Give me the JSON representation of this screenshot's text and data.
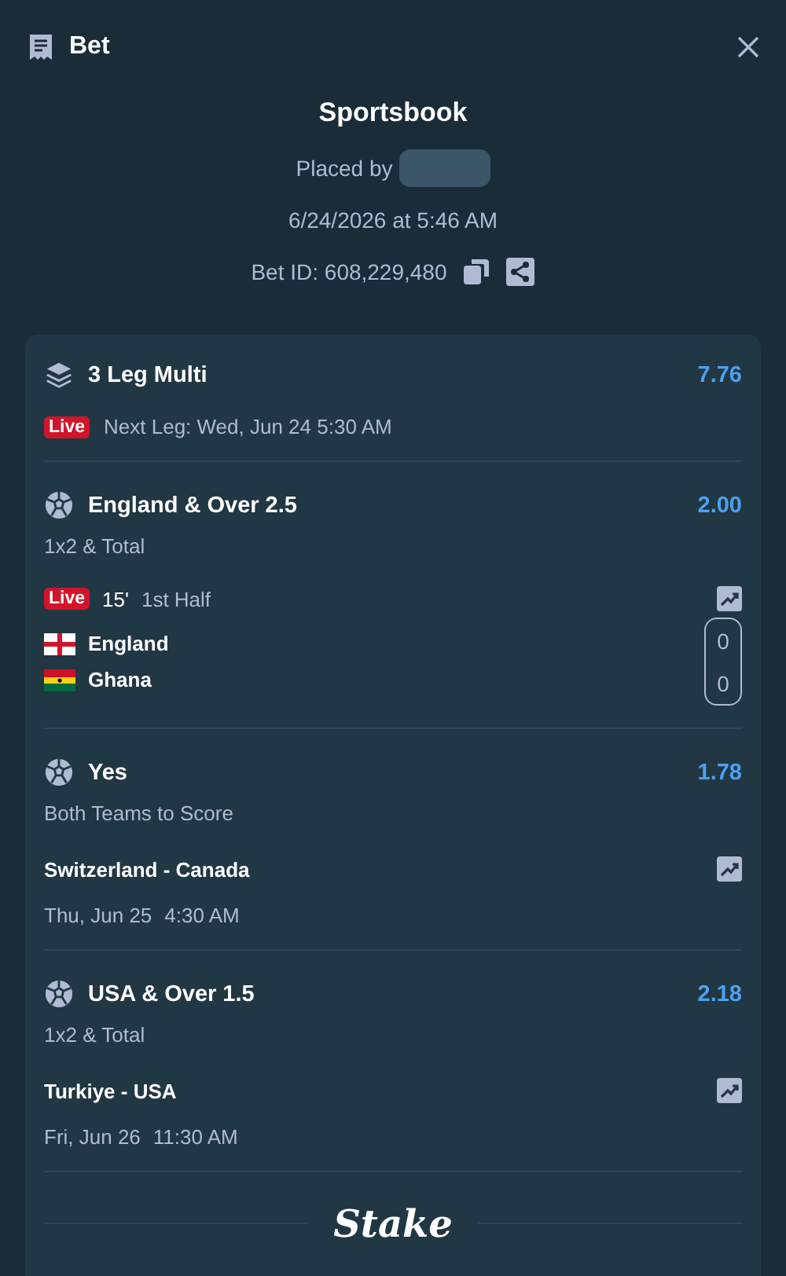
{
  "header": {
    "title": "Bet"
  },
  "summary": {
    "title": "Sportsbook",
    "placed_by": "Placed by",
    "date": "6/24/2026 at 5:46 AM",
    "bet_id": "Bet ID: 608,229,480"
  },
  "multi": {
    "title": "3 Leg Multi",
    "odds": "7.76",
    "live": true,
    "live_label": "Live",
    "next_leg": "Next Leg: Wed, Jun 24 5:30 AM"
  },
  "legs": [
    {
      "kind": "live",
      "selection": "England & Over 2.5",
      "odds": "2.00",
      "market": "1x2 & Total",
      "live_label": "Live",
      "minute": "15'",
      "period": "1st Half",
      "teams": [
        {
          "name": "England",
          "kind": "cross_flag",
          "score": "0"
        },
        {
          "name": "Ghana",
          "kind": "striped_flag",
          "score": "0"
        }
      ]
    },
    {
      "kind": "scheduled",
      "selection": "Yes",
      "odds": "1.78",
      "market": "Both Teams to Score",
      "match": "Switzerland - Canada",
      "date": "Thu, Jun 25",
      "time": "4:30 AM"
    },
    {
      "kind": "scheduled",
      "selection": "USA & Over 1.5",
      "odds": "2.18",
      "market": "1x2 & Total",
      "match": "Turkiye - USA",
      "date": "Fri, Jun 26",
      "time": "11:30 AM"
    }
  ],
  "brand": "Stake"
}
